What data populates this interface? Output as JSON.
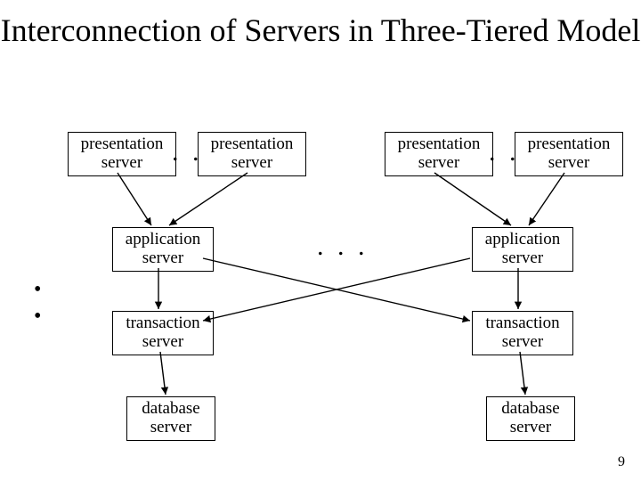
{
  "title": "Interconnection of Servers in\nThree-Tiered Model",
  "boxes": {
    "pres1": "presentation\nserver",
    "pres2": "presentation\nserver",
    "pres3": "presentation\nserver",
    "pres4": "presentation\nserver",
    "appL": "application\nserver",
    "appR": "application\nserver",
    "tranL": "transaction\nserver",
    "tranR": "transaction\nserver",
    "dbL": "database\nserver",
    "dbR": "database\nserver"
  },
  "dots": {
    "topL": ". .",
    "topR": ". .",
    "mid": ". . ."
  },
  "pagenum": "9"
}
